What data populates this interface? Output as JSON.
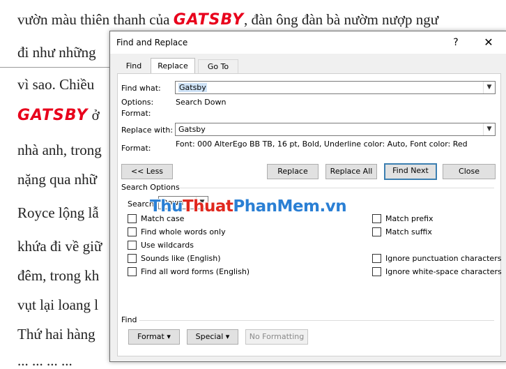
{
  "document": {
    "lines": [
      {
        "pre": "vườn màu thiên thanh của ",
        "brand": "GATSBY",
        "post": ", đàn ông đàn bà nườm nượp ngư"
      },
      {
        "pre": "đi như những"
      },
      {
        "pre": "vì sao. Chiều"
      },
      {
        "brand": "GATSBY",
        "post": " ở"
      },
      {
        "pre": "nhà anh, trong"
      },
      {
        "pre": "nặng qua nhữ"
      },
      {
        "pre": "Royce lộng lẫ"
      },
      {
        "pre": "khứa đi về giữ"
      },
      {
        "pre": "đêm, trong kh"
      },
      {
        "pre": "vụt lại loang l"
      },
      {
        "pre": "Thứ hai hàng"
      },
      {
        "pre": "... ... ... ..."
      }
    ]
  },
  "dialog": {
    "title": "Find and Replace",
    "help": "?",
    "close": "✕",
    "tabs": {
      "find": "Find",
      "replace": "Replace",
      "goto": "Go To"
    },
    "find_what_label": "Find what:",
    "find_what_value": "Gatsby",
    "options_label": "Options:",
    "options_value": "Search Down",
    "format_label": "Format:",
    "replace_with_label": "Replace with:",
    "replace_with_value": "Gatsby",
    "format2_label": "Format:",
    "format2_value": "Font: 000 AlterEgo BB TB, 16 pt, Bold, Underline color: Auto, Font color: Red",
    "buttons": {
      "less": "<< Less",
      "replace": "Replace",
      "replace_all": "Replace All",
      "find_next": "Find Next",
      "close": "Close"
    },
    "search_options_label": "Search Options",
    "search_label": "Search:",
    "search_value": "Down",
    "checkboxes_left": [
      "Match case",
      "Find whole words only",
      "Use wildcards",
      "Sounds like (English)",
      "Find all word forms (English)"
    ],
    "checkboxes_right": [
      "Match prefix",
      "Match suffix",
      "Ignore punctuation characters",
      "Ignore white-space characters"
    ],
    "find_section_label": "Find",
    "bottom_buttons": {
      "format": "Format",
      "special": "Special",
      "no_formatting": "No Formatting"
    }
  },
  "watermark": {
    "part1": "Thu",
    "part2": "Thuat",
    "part3": "PhanMem.vn"
  },
  "colors": {
    "brand_red": "#e8001c",
    "accent_blue": "#3c7fb1"
  }
}
